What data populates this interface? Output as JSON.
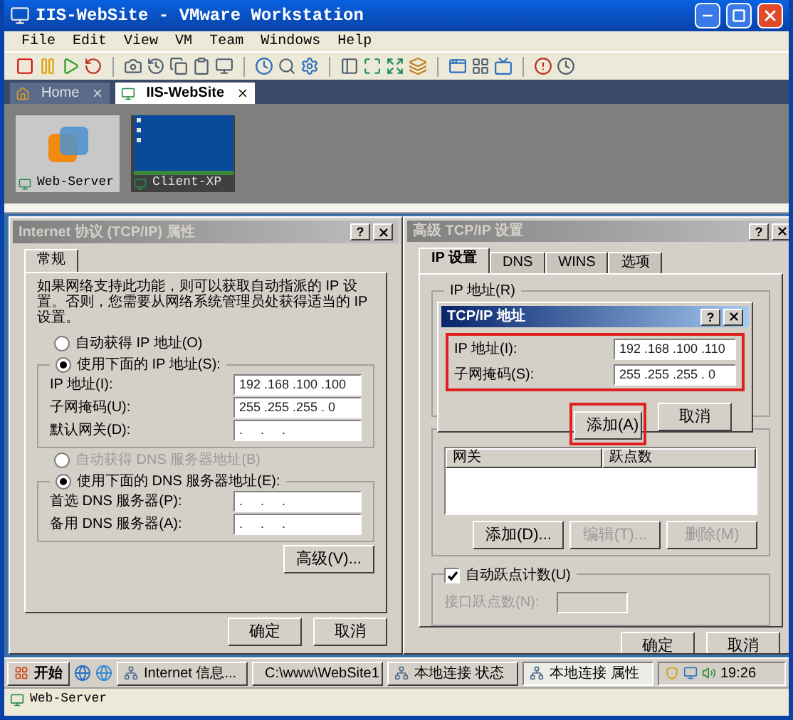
{
  "window": {
    "title": "IIS-WebSite - VMware Workstation"
  },
  "menu": [
    "File",
    "Edit",
    "View",
    "VM",
    "Team",
    "Windows",
    "Help"
  ],
  "tabs": [
    {
      "label": "Home",
      "selected": false
    },
    {
      "label": "IIS-WebSite",
      "selected": true
    }
  ],
  "thumbnails": [
    {
      "label": "Web-Server",
      "selected": true,
      "kind": "logo"
    },
    {
      "label": "Client-XP",
      "selected": false,
      "kind": "desktop"
    }
  ],
  "tcpip_dialog": {
    "title": "Internet 协议 (TCP/IP) 属性",
    "help": "?",
    "tabs": [
      {
        "label": "常规",
        "selected": true
      }
    ],
    "description": "如果网络支持此功能，则可以获取自动指派的 IP 设置。否则，您需要从网络系统管理员处获得适当的 IP 设置。",
    "ip_options": [
      {
        "label": "自动获得 IP 地址(O)",
        "selected": false,
        "disabled": false
      },
      {
        "label": "使用下面的 IP 地址(S):",
        "selected": true,
        "disabled": false
      }
    ],
    "ip_fields": [
      {
        "label": "IP 地址(I):",
        "value": "192 .168 .100 .100"
      },
      {
        "label": "子网掩码(U):",
        "value": "255 .255 .255 . 0"
      },
      {
        "label": "默认网关(D):",
        "value": ".     .     ."
      }
    ],
    "dns_options": [
      {
        "label": "自动获得 DNS 服务器地址(B)",
        "selected": false,
        "disabled": true
      },
      {
        "label": "使用下面的 DNS 服务器地址(E):",
        "selected": true,
        "disabled": false
      }
    ],
    "dns_fields": [
      {
        "label": "首选 DNS 服务器(P):",
        "value": ".     .     ."
      },
      {
        "label": "备用 DNS 服务器(A):",
        "value": ".     .     ."
      }
    ],
    "advanced_button": "高级(V)...",
    "ok_button": "确定",
    "cancel_button": "取消"
  },
  "advanced_dialog": {
    "title": "高级 TCP/IP 设置",
    "help": "?",
    "tabs": [
      {
        "label": "IP 设置",
        "selected": true
      },
      {
        "label": "DNS",
        "selected": false
      },
      {
        "label": "WINS",
        "selected": false
      },
      {
        "label": "选项",
        "selected": false
      }
    ],
    "ip_group": "IP 地址(R)",
    "gateway_columns": [
      "网关",
      "跃点数"
    ],
    "gateway_buttons": [
      {
        "label": "添加(D)...",
        "disabled": false
      },
      {
        "label": "编辑(T)...",
        "disabled": true
      },
      {
        "label": "删除(M)",
        "disabled": true
      }
    ],
    "auto_metric": {
      "label": "自动跃点计数(U)",
      "checked": true
    },
    "interface_metric": {
      "label": "接口跃点数(N):",
      "disabled": true
    },
    "ok_button": "确定",
    "cancel_button": "取消"
  },
  "address_dialog": {
    "title": "TCP/IP 地址",
    "help": "?",
    "fields": [
      {
        "label": "IP 地址(I):",
        "value": "192 .168 .100 .110"
      },
      {
        "label": "子网掩码(S):",
        "value": "255 .255 .255 . 0"
      }
    ],
    "add_button": "添加(A)",
    "cancel_button": "取消"
  },
  "taskbar": {
    "start": "开始",
    "tasks": [
      {
        "label": "Internet 信息...",
        "selected": false
      },
      {
        "label": "C:\\www\\WebSite1",
        "selected": false
      },
      {
        "label": "本地连接 状态",
        "selected": false
      },
      {
        "label": "本地连接 属性",
        "selected": true
      }
    ],
    "clock": "19:26"
  },
  "status_bar": {
    "text": "Web-Server"
  }
}
